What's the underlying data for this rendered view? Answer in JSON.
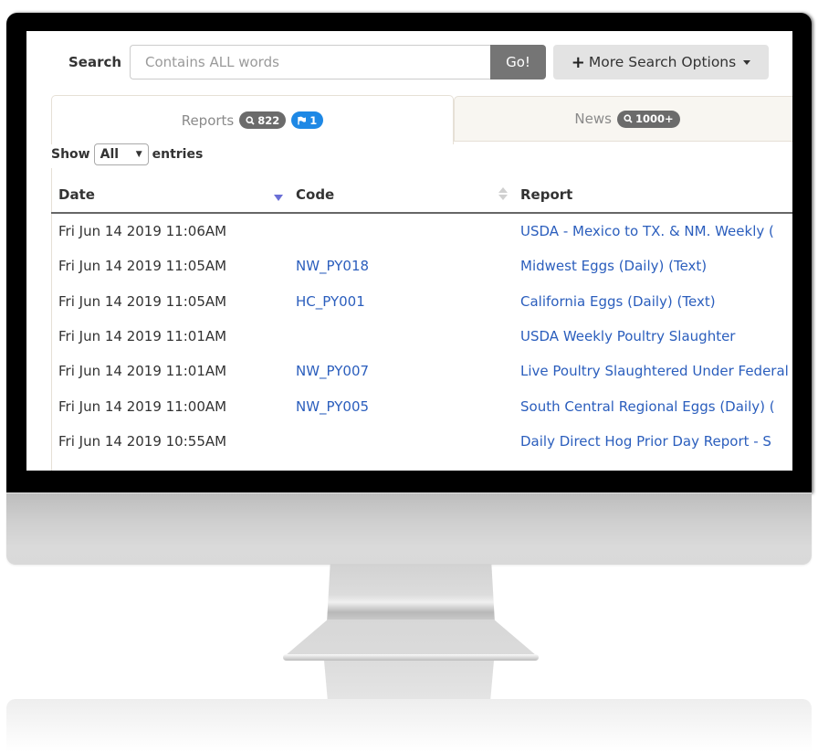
{
  "search": {
    "label": "Search",
    "placeholder": "Contains ALL words",
    "value": "",
    "go_label": "Go!",
    "more_options_label": "More Search Options"
  },
  "tabs": [
    {
      "label": "Reports",
      "active": true,
      "search_count": "822",
      "flag_count": "1"
    },
    {
      "label": "News",
      "active": false,
      "search_count": "1000+"
    }
  ],
  "entries": {
    "show_label": "Show",
    "selected": "All",
    "entries_label": "entries"
  },
  "table": {
    "columns": [
      "Date",
      "Code",
      "Report"
    ],
    "sort": {
      "column": "Date",
      "direction": "descending"
    },
    "rows": [
      {
        "date": "Fri Jun 14 2019 11:06AM",
        "code": "",
        "report": "USDA - Mexico to TX. & NM. Weekly ("
      },
      {
        "date": "Fri Jun 14 2019 11:05AM",
        "code": "NW_PY018",
        "report": "Midwest Eggs (Daily) (Text)"
      },
      {
        "date": "Fri Jun 14 2019 11:05AM",
        "code": "HC_PY001",
        "report": "California Eggs (Daily) (Text)"
      },
      {
        "date": "Fri Jun 14 2019 11:01AM",
        "code": "",
        "report": "USDA Weekly Poultry Slaughter"
      },
      {
        "date": "Fri Jun 14 2019 11:01AM",
        "code": "NW_PY007",
        "report": "Live Poultry Slaughtered Under Federal"
      },
      {
        "date": "Fri Jun 14 2019 11:00AM",
        "code": "NW_PY005",
        "report": "South Central Regional Eggs (Daily) ("
      },
      {
        "date": "Fri Jun 14 2019 10:55AM",
        "code": "",
        "report": "Daily Direct Hog Prior Day Report - S"
      }
    ]
  },
  "colors": {
    "link": "#2b5ebd",
    "go_button": "#757575",
    "badge_gray": "#6b6b6b",
    "badge_blue": "#1e88e5",
    "sort_active": "#6a6fd6"
  }
}
